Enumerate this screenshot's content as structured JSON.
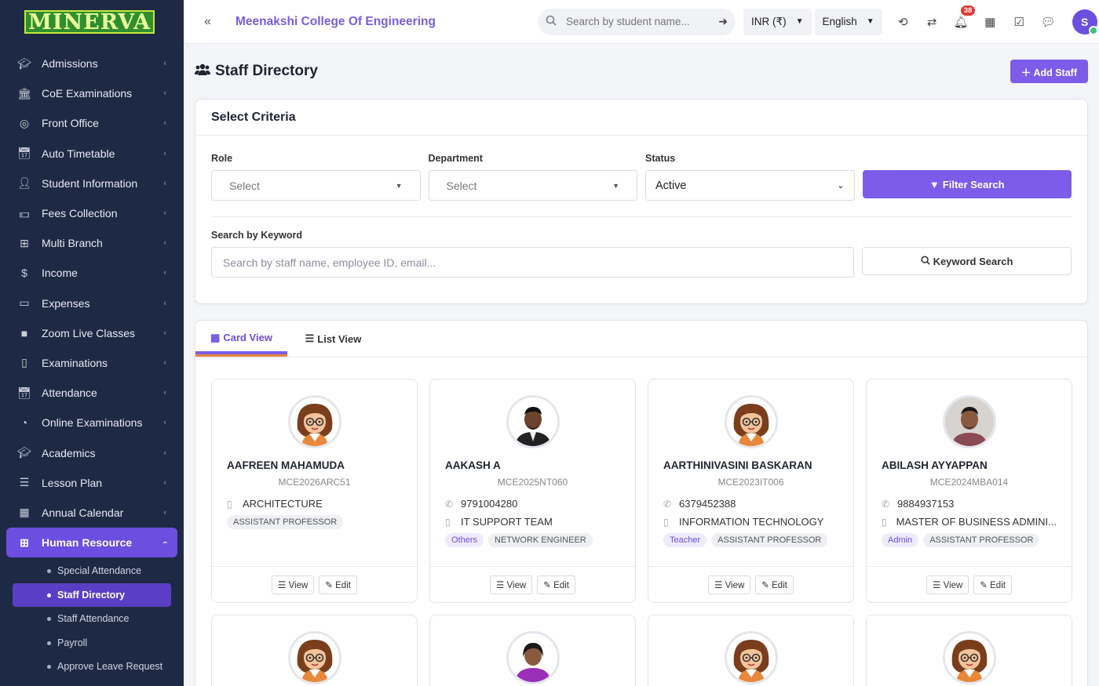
{
  "logo": "MINERVA",
  "sidebar": {
    "items": [
      {
        "label": "Admissions",
        "icon": "graduation-cap-icon"
      },
      {
        "label": "CoE Examinations",
        "icon": "bank-icon"
      },
      {
        "label": "Front Office",
        "icon": "front-office-icon"
      },
      {
        "label": "Auto Timetable",
        "icon": "calendar-check-icon"
      },
      {
        "label": "Student Information",
        "icon": "user-plus-icon"
      },
      {
        "label": "Fees Collection",
        "icon": "money-icon"
      },
      {
        "label": "Multi Branch",
        "icon": "sitemap-icon"
      },
      {
        "label": "Income",
        "icon": "dollar-icon"
      },
      {
        "label": "Expenses",
        "icon": "credit-card-icon"
      },
      {
        "label": "Zoom Live Classes",
        "icon": "video-icon"
      },
      {
        "label": "Examinations",
        "icon": "map-icon"
      },
      {
        "label": "Attendance",
        "icon": "calendar-check-icon"
      },
      {
        "label": "Online Examinations",
        "icon": "rss-icon"
      },
      {
        "label": "Academics",
        "icon": "graduation-cap-icon"
      },
      {
        "label": "Lesson Plan",
        "icon": "list-icon"
      },
      {
        "label": "Annual Calendar",
        "icon": "calendar-icon"
      },
      {
        "label": "Human Resource",
        "icon": "sitemap-icon"
      }
    ],
    "sub_items": [
      "Special Attendance",
      "Staff Directory",
      "Staff Attendance",
      "Payroll",
      "Approve Leave Request"
    ]
  },
  "topbar": {
    "college": "Meenakshi College Of Engineering",
    "search_placeholder": "Search by student name...",
    "currency": "INR (₹)",
    "language": "English",
    "notifications": "38",
    "user_initial": "S"
  },
  "page": {
    "title": "Staff Directory",
    "add_label": "Add Staff"
  },
  "criteria": {
    "title": "Select Criteria",
    "role_label": "Role",
    "role_value": "Select",
    "dept_label": "Department",
    "dept_value": "Select",
    "status_label": "Status",
    "status_value": "Active",
    "filter_label": "Filter Search",
    "keyword_label": "Search by Keyword",
    "keyword_placeholder": "Search by staff name, employee ID, email...",
    "keyword_btn": "Keyword Search"
  },
  "views": {
    "card": "Card View",
    "list": "List View"
  },
  "staff": [
    {
      "name": "AAFREEN MAHAMUDA",
      "id": "MCE2026ARC51",
      "phone": "",
      "dept": "ARCHITECTURE",
      "category": "",
      "designation": "ASSISTANT PROFESSOR",
      "avatar": "female"
    },
    {
      "name": "AAKASH A",
      "id": "MCE2025NT060",
      "phone": "9791004280",
      "dept": "IT SUPPORT TEAM",
      "category": "Others",
      "designation": "NETWORK ENGINEER",
      "avatar": "photo-male-1"
    },
    {
      "name": "AARTHINIVASINI BASKARAN",
      "id": "MCE2023IT006",
      "phone": "6379452388",
      "dept": "INFORMATION TECHNOLOGY",
      "category": "Teacher",
      "designation": "ASSISTANT PROFESSOR",
      "avatar": "female"
    },
    {
      "name": "ABILASH AYYAPPAN",
      "id": "MCE2024MBA014",
      "phone": "9884937153",
      "dept": "MASTER OF BUSINESS ADMINI...",
      "category": "Admin",
      "designation": "ASSISTANT PROFESSOR",
      "avatar": "photo-male-2"
    }
  ],
  "card_actions": {
    "view": "View",
    "edit": "Edit"
  },
  "colors": {
    "accent": "#7c5ce8",
    "sidebar": "#1e2a45",
    "badge": "#e53935"
  }
}
